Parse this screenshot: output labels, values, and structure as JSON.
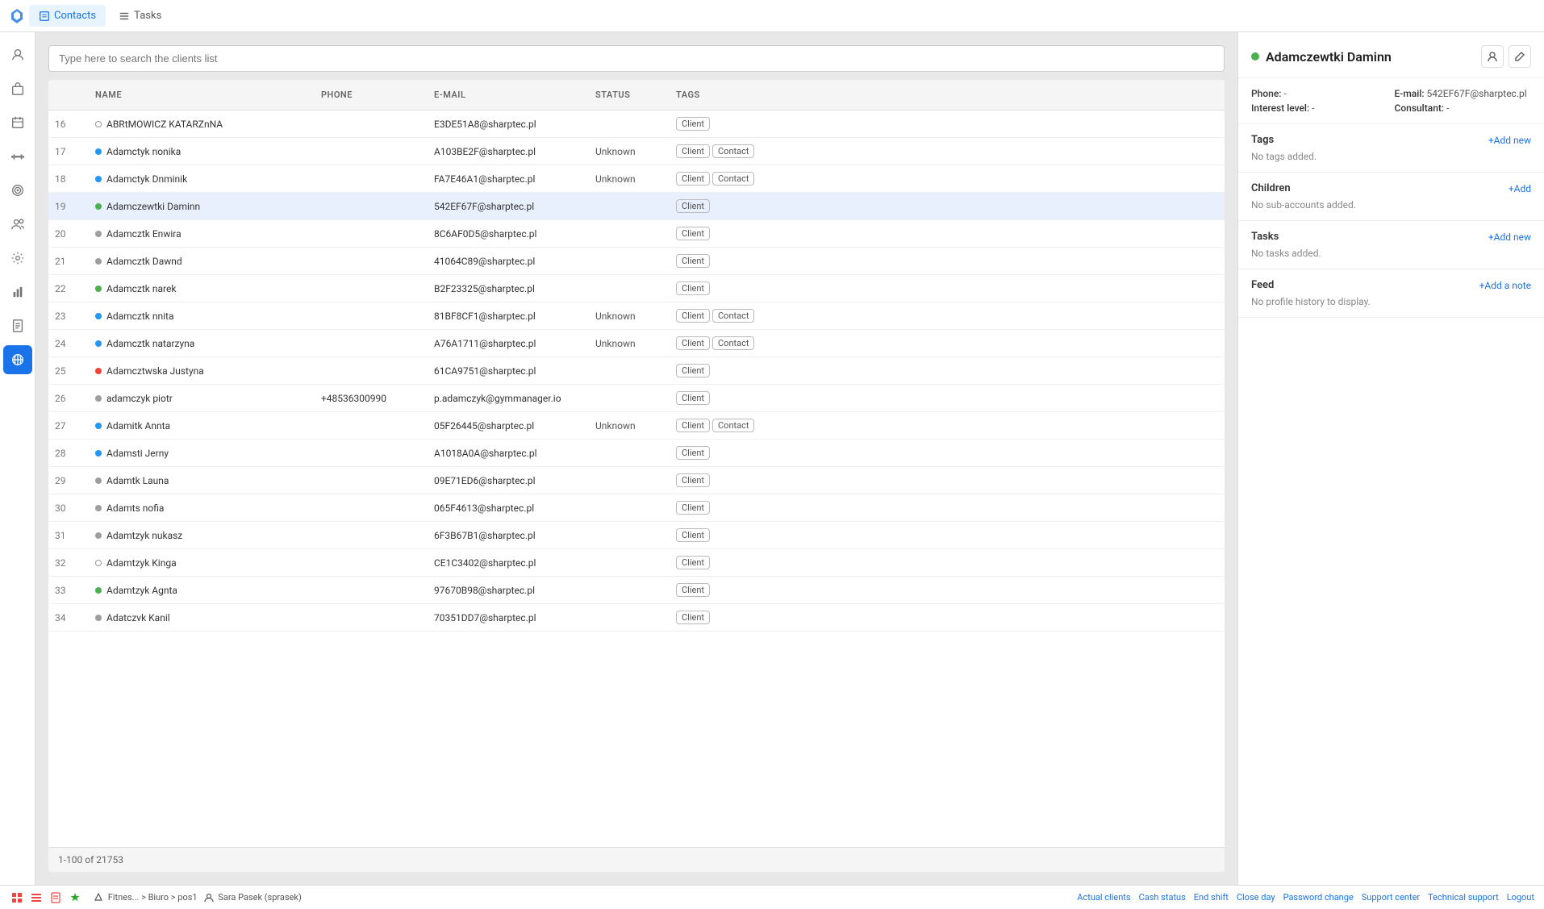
{
  "app": {
    "logo_color": "#1a73e8"
  },
  "top_nav": {
    "tabs": [
      {
        "id": "contacts",
        "icon": "contacts",
        "label": "Contacts",
        "active": true
      },
      {
        "id": "tasks",
        "icon": "tasks",
        "label": "Tasks",
        "active": false
      }
    ]
  },
  "sidebar": {
    "items": [
      {
        "id": "user",
        "icon": "user",
        "active": false
      },
      {
        "id": "shopping",
        "icon": "shopping-bag",
        "active": false
      },
      {
        "id": "calendar",
        "icon": "calendar",
        "active": false
      },
      {
        "id": "dumbbell",
        "icon": "dumbbell",
        "active": false
      },
      {
        "id": "target",
        "icon": "target",
        "active": false
      },
      {
        "id": "people",
        "icon": "people",
        "active": false
      },
      {
        "id": "settings",
        "icon": "settings",
        "active": false
      },
      {
        "id": "reports",
        "icon": "reports",
        "active": false
      },
      {
        "id": "document",
        "icon": "document",
        "active": false
      },
      {
        "id": "network",
        "icon": "network",
        "active": true
      }
    ]
  },
  "search": {
    "placeholder": "Type here to search the clients list",
    "value": ""
  },
  "table": {
    "columns": [
      "",
      "NAME",
      "PHONE",
      "E-MAIL",
      "STATUS",
      "TAGS"
    ],
    "rows": [
      {
        "num": 16,
        "dot": "empty",
        "name": "ABRtMOWICZ KATARZnNA",
        "phone": "",
        "email": "E3DE51A8@sharptec.pl",
        "status": "",
        "tags": [
          "Client"
        ]
      },
      {
        "num": 17,
        "dot": "blue",
        "name": "Adamctyk nonika",
        "phone": "",
        "email": "A103BE2F@sharptec.pl",
        "status": "Unknown",
        "tags": [
          "Client",
          "Contact"
        ]
      },
      {
        "num": 18,
        "dot": "blue",
        "name": "Adamctyk Dnminik",
        "phone": "",
        "email": "FA7E46A1@sharptec.pl",
        "status": "Unknown",
        "tags": [
          "Client",
          "Contact"
        ]
      },
      {
        "num": 19,
        "dot": "green",
        "name": "Adamczewtki Daminn",
        "phone": "",
        "email": "542EF67F@sharptec.pl",
        "status": "",
        "tags": [
          "Client"
        ],
        "selected": true
      },
      {
        "num": 20,
        "dot": "gray",
        "name": "Adamcztk Enwira",
        "phone": "",
        "email": "8C6AF0D5@sharptec.pl",
        "status": "",
        "tags": [
          "Client"
        ]
      },
      {
        "num": 21,
        "dot": "gray",
        "name": "Adamcztk Dawnd",
        "phone": "",
        "email": "41064C89@sharptec.pl",
        "status": "",
        "tags": [
          "Client"
        ]
      },
      {
        "num": 22,
        "dot": "green",
        "name": "Adamcztk narek",
        "phone": "",
        "email": "B2F23325@sharptec.pl",
        "status": "",
        "tags": [
          "Client"
        ]
      },
      {
        "num": 23,
        "dot": "blue",
        "name": "Adamcztk nnita",
        "phone": "",
        "email": "81BF8CF1@sharptec.pl",
        "status": "Unknown",
        "tags": [
          "Client",
          "Contact"
        ]
      },
      {
        "num": 24,
        "dot": "blue",
        "name": "Adamcztk natarzyna",
        "phone": "",
        "email": "A76A1711@sharptec.pl",
        "status": "Unknown",
        "tags": [
          "Client",
          "Contact"
        ]
      },
      {
        "num": 25,
        "dot": "red",
        "name": "Adamcztwska Justyna",
        "phone": "",
        "email": "61CA9751@sharptec.pl",
        "status": "",
        "tags": [
          "Client"
        ]
      },
      {
        "num": 26,
        "dot": "gray",
        "name": "adamczyk piotr",
        "phone": "+48536300990",
        "email": "p.adamczyk@gymmanager.io",
        "status": "",
        "tags": [
          "Client"
        ]
      },
      {
        "num": 27,
        "dot": "blue",
        "name": "Adamitk Annta",
        "phone": "",
        "email": "05F26445@sharptec.pl",
        "status": "Unknown",
        "tags": [
          "Client",
          "Contact"
        ]
      },
      {
        "num": 28,
        "dot": "blue",
        "name": "Adamsti Jerny",
        "phone": "",
        "email": "A1018A0A@sharptec.pl",
        "status": "",
        "tags": [
          "Client"
        ]
      },
      {
        "num": 29,
        "dot": "gray",
        "name": "Adamtk Launa",
        "phone": "",
        "email": "09E71ED6@sharptec.pl",
        "status": "",
        "tags": [
          "Client"
        ]
      },
      {
        "num": 30,
        "dot": "gray",
        "name": "Adamts nofia",
        "phone": "",
        "email": "065F4613@sharptec.pl",
        "status": "",
        "tags": [
          "Client"
        ]
      },
      {
        "num": 31,
        "dot": "gray",
        "name": "Adamtzyk nukasz",
        "phone": "",
        "email": "6F3B67B1@sharptec.pl",
        "status": "",
        "tags": [
          "Client"
        ]
      },
      {
        "num": 32,
        "dot": "empty",
        "name": "Adamtzyk Kinga",
        "phone": "",
        "email": "CE1C3402@sharptec.pl",
        "status": "",
        "tags": [
          "Client"
        ]
      },
      {
        "num": 33,
        "dot": "green",
        "name": "Adamtzyk Agnta",
        "phone": "",
        "email": "97670B98@sharptec.pl",
        "status": "",
        "tags": [
          "Client"
        ]
      },
      {
        "num": 34,
        "dot": "gray",
        "name": "Adatczvk Kanil",
        "phone": "",
        "email": "70351DD7@sharptec.pl",
        "status": "",
        "tags": [
          "Client"
        ]
      }
    ],
    "pagination": "1-100 of 21753"
  },
  "detail": {
    "name": "Adamczewtki Daminn",
    "status_dot": "green",
    "phone_label": "Phone:",
    "phone_value": "-",
    "email_label": "E-mail:",
    "email_value": "542EF67F@sharptec.pl",
    "interest_label": "Interest level:",
    "interest_value": "-",
    "consultant_label": "Consultant:",
    "consultant_value": "-",
    "sections": {
      "tags": {
        "title": "Tags",
        "add_label": "+Add new",
        "empty_text": "No tags added."
      },
      "children": {
        "title": "Children",
        "add_label": "+Add",
        "empty_text": "No sub-accounts added."
      },
      "tasks": {
        "title": "Tasks",
        "add_label": "+Add new",
        "empty_text": "No tasks added."
      },
      "feed": {
        "title": "Feed",
        "add_label": "+Add a note",
        "empty_text": "No profile history to display."
      }
    }
  },
  "status_bar": {
    "icons": [
      "grid1",
      "grid2",
      "file",
      "star"
    ],
    "breadcrumb": "Fitnes... > Biuro > pos1",
    "user": "Sara Pasek (sprasek)",
    "links": [
      {
        "id": "actual-clients",
        "label": "Actual clients"
      },
      {
        "id": "cash-status",
        "label": "Cash status"
      },
      {
        "id": "end-shift",
        "label": "End shift"
      },
      {
        "id": "close-day",
        "label": "Close day"
      },
      {
        "id": "password-change",
        "label": "Password change"
      },
      {
        "id": "support-center",
        "label": "Support center"
      },
      {
        "id": "technical-support",
        "label": "Technical support"
      },
      {
        "id": "logout",
        "label": "Logout"
      }
    ]
  }
}
